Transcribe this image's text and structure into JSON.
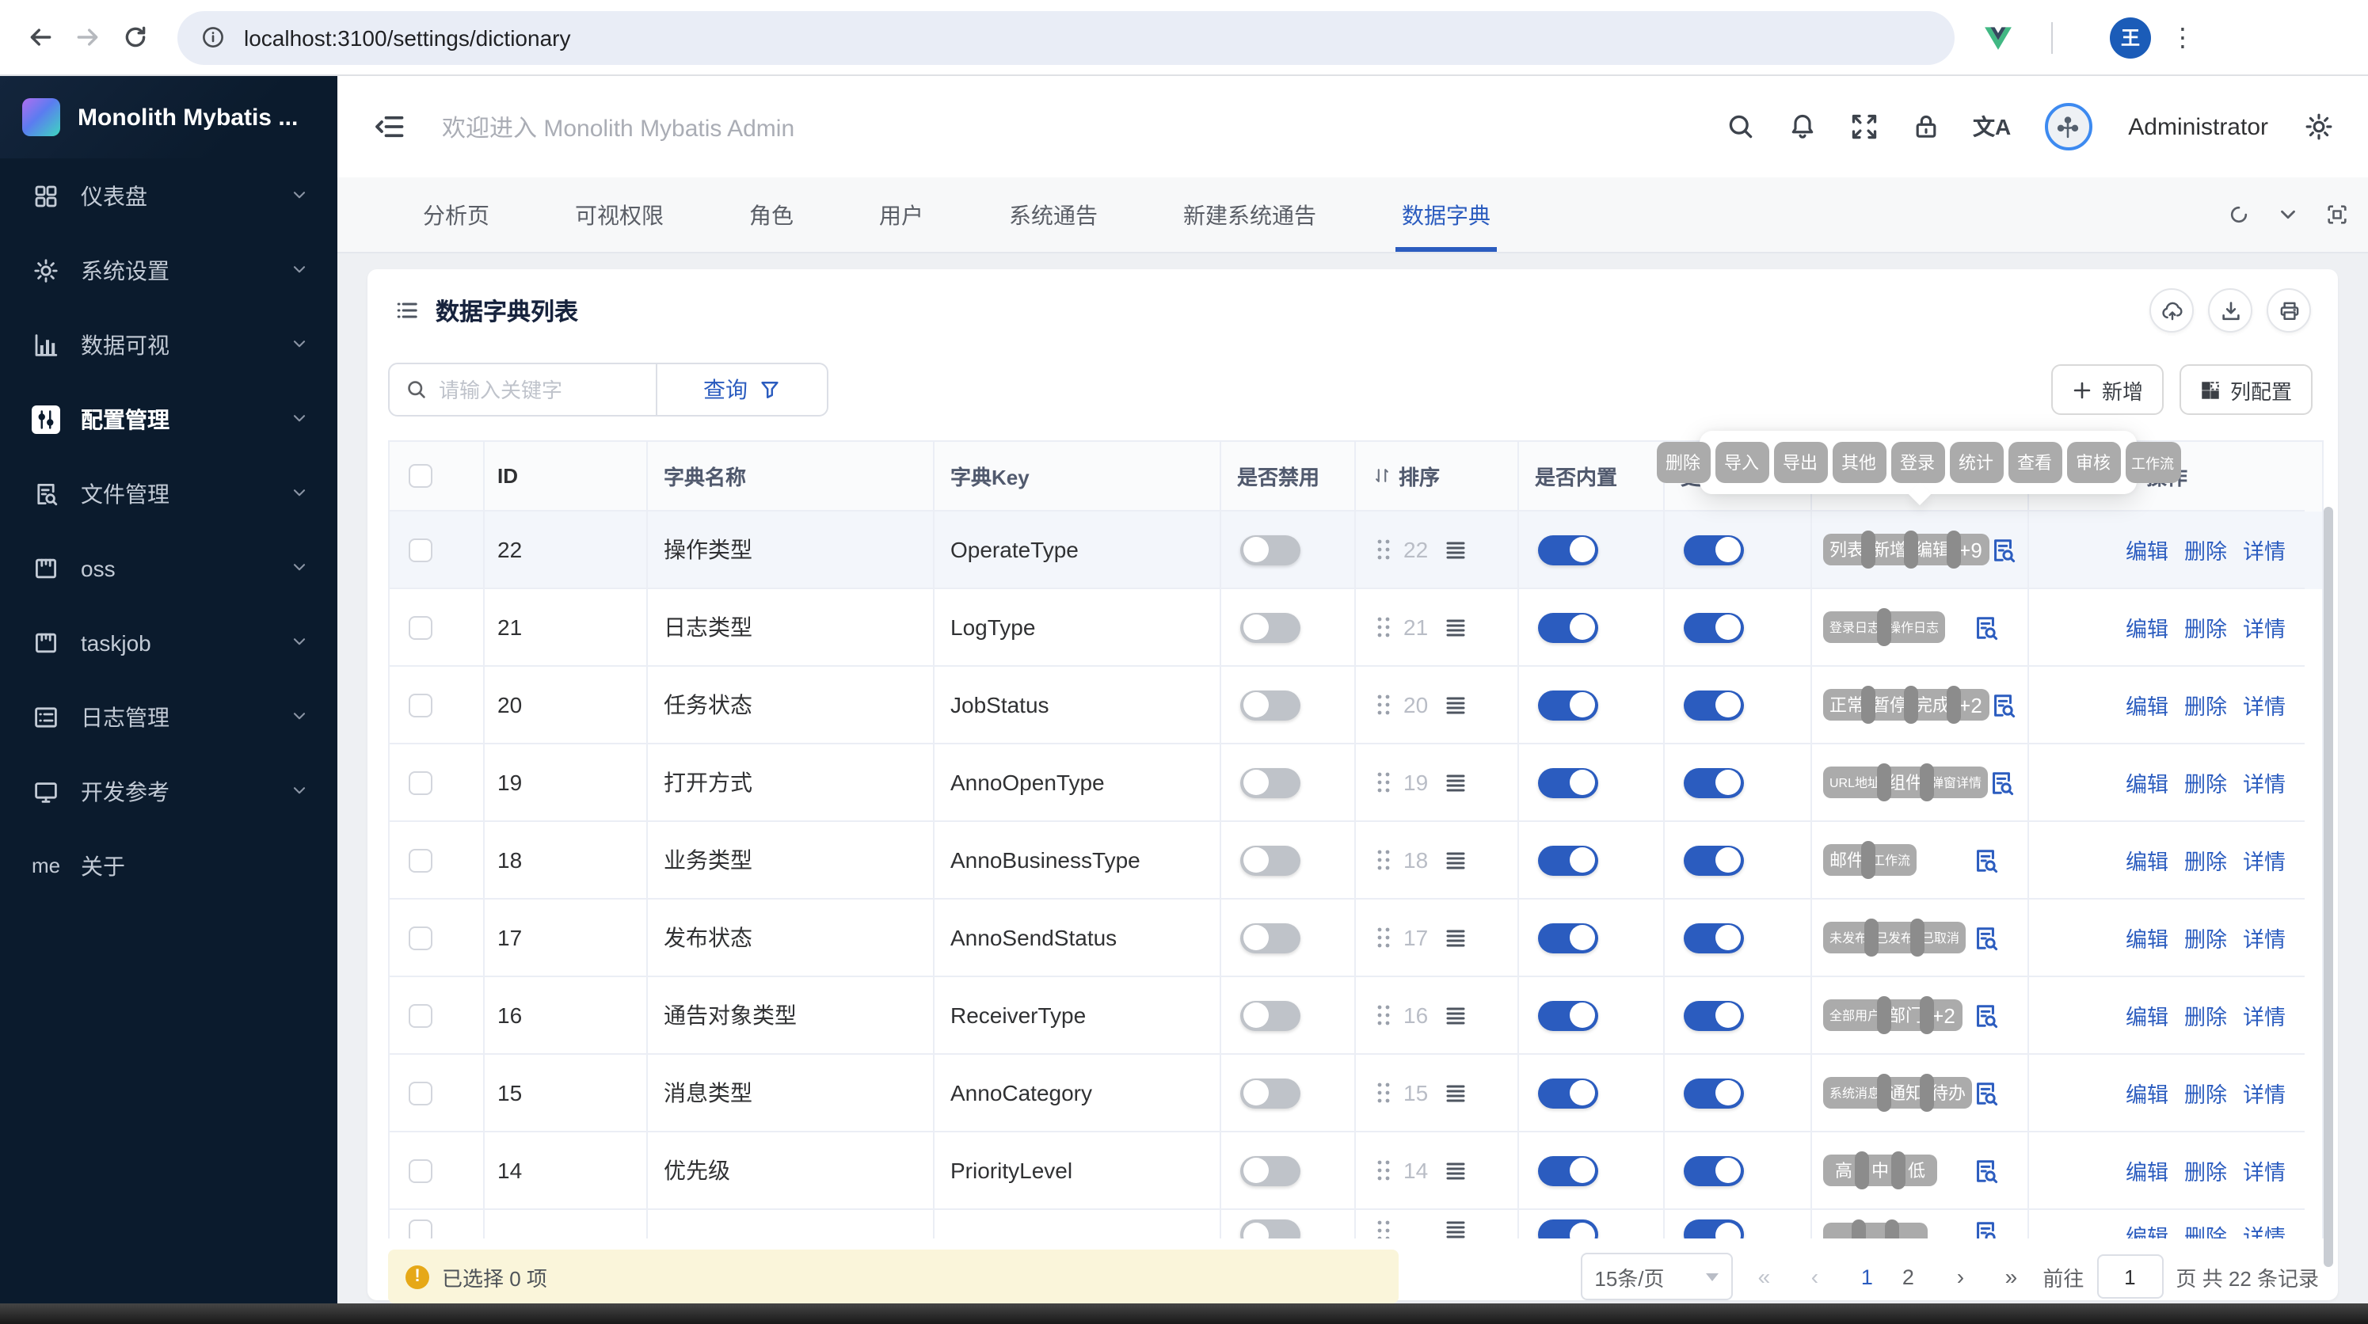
{
  "browser": {
    "url": "localhost:3100/settings/dictionary",
    "profile_glyph": "王"
  },
  "sidebar": {
    "app_title": "Monolith Mybatis ...",
    "items": [
      {
        "key": "dashboard",
        "icon": "dashboard",
        "label": "仪表盘",
        "chevron": true,
        "active": false
      },
      {
        "key": "system-settings",
        "icon": "gear",
        "label": "系统设置",
        "chevron": true,
        "active": false
      },
      {
        "key": "data-visual",
        "icon": "chart",
        "label": "数据可视",
        "chevron": true,
        "active": false
      },
      {
        "key": "config-management",
        "icon": "sliders",
        "label": "配置管理",
        "chevron": true,
        "active": true
      },
      {
        "key": "file-management",
        "icon": "filesearch",
        "label": "文件管理",
        "chevron": true,
        "active": false
      },
      {
        "key": "oss",
        "icon": "box",
        "label": "oss",
        "chevron": true,
        "active": false
      },
      {
        "key": "taskjob",
        "icon": "box",
        "label": "taskjob",
        "chevron": true,
        "active": false
      },
      {
        "key": "log-management",
        "icon": "list",
        "label": "日志管理",
        "chevron": true,
        "active": false
      },
      {
        "key": "dev-reference",
        "icon": "monitor",
        "label": "开发参考",
        "chevron": true,
        "active": false
      },
      {
        "key": "about",
        "icon": "me",
        "label": "关于",
        "chevron": false,
        "active": false
      }
    ]
  },
  "topbar": {
    "welcome": "欢迎进入 Monolith Mybatis Admin",
    "username": "Administrator"
  },
  "tabs": {
    "items": [
      {
        "key": "analysis",
        "label": "分析页",
        "active": false
      },
      {
        "key": "permissions",
        "label": "可视权限",
        "active": false
      },
      {
        "key": "roles",
        "label": "角色",
        "active": false
      },
      {
        "key": "users",
        "label": "用户",
        "active": false
      },
      {
        "key": "notices",
        "label": "系统通告",
        "active": false
      },
      {
        "key": "new-notice",
        "label": "新建系统通告",
        "active": false
      },
      {
        "key": "dictionary",
        "label": "数据字典",
        "active": true
      }
    ]
  },
  "card": {
    "title": "数据字典列表"
  },
  "toolbar": {
    "search_placeholder": "请输入关键字",
    "query_label": "查询",
    "add_label": "新增",
    "columns_label": "列配置"
  },
  "table": {
    "headers": {
      "id": "ID",
      "name": "字典名称",
      "key": "字典Key",
      "disabled": "是否禁用",
      "sort": "排序",
      "builtin": "是否内置",
      "update": "更新",
      "tags": "",
      "actions": "操作"
    },
    "action_labels": [
      "编辑",
      "删除",
      "详情"
    ],
    "rows": [
      {
        "id": "22",
        "name": "操作类型",
        "key": "OperateType",
        "disabled": false,
        "sort": "22",
        "builtin": true,
        "update": true,
        "tags": [
          "列表",
          "新增",
          "编辑"
        ],
        "more": "+9",
        "hover": true
      },
      {
        "id": "21",
        "name": "日志类型",
        "key": "LogType",
        "disabled": false,
        "sort": "21",
        "builtin": true,
        "update": true,
        "tags": [
          "登录日志",
          "操作日志"
        ],
        "more": null
      },
      {
        "id": "20",
        "name": "任务状态",
        "key": "JobStatus",
        "disabled": false,
        "sort": "20",
        "builtin": true,
        "update": true,
        "tags": [
          "正常",
          "暂停",
          "完成"
        ],
        "more": "+2"
      },
      {
        "id": "19",
        "name": "打开方式",
        "key": "AnnoOpenType",
        "disabled": false,
        "sort": "19",
        "builtin": true,
        "update": true,
        "tags": [
          "URL地址",
          "组件",
          "弹窗详情"
        ],
        "more": null
      },
      {
        "id": "18",
        "name": "业务类型",
        "key": "AnnoBusinessType",
        "disabled": false,
        "sort": "18",
        "builtin": true,
        "update": true,
        "tags": [
          "邮件",
          "工作流"
        ],
        "more": null
      },
      {
        "id": "17",
        "name": "发布状态",
        "key": "AnnoSendStatus",
        "disabled": false,
        "sort": "17",
        "builtin": true,
        "update": true,
        "tags": [
          "未发布",
          "已发布",
          "已取消"
        ],
        "more": null
      },
      {
        "id": "16",
        "name": "通告对象类型",
        "key": "ReceiverType",
        "disabled": false,
        "sort": "16",
        "builtin": true,
        "update": true,
        "tags": [
          "全部用户",
          "部门"
        ],
        "more": "+2"
      },
      {
        "id": "15",
        "name": "消息类型",
        "key": "AnnoCategory",
        "disabled": false,
        "sort": "15",
        "builtin": true,
        "update": true,
        "tags": [
          "系统消息",
          "通知",
          "待办"
        ],
        "more": null
      },
      {
        "id": "14",
        "name": "优先级",
        "key": "PriorityLevel",
        "disabled": false,
        "sort": "14",
        "builtin": true,
        "update": true,
        "tags": [
          "高",
          "中",
          "低"
        ],
        "more": null
      },
      {
        "id": "",
        "name": "",
        "key": "",
        "disabled": false,
        "sort": "",
        "builtin": true,
        "update": true,
        "tags": [
          "",
          "",
          ""
        ],
        "more": null,
        "partial": true
      }
    ]
  },
  "popup": {
    "tags": [
      "删除",
      "导入",
      "导出",
      "其他",
      "登录",
      "统计",
      "查看",
      "审核",
      "工作流"
    ]
  },
  "footer": {
    "selected_text": "已选择 0 项",
    "page_size": "15条/页",
    "pages": [
      "1",
      "2"
    ],
    "active_page": "1",
    "goto_label": "前往",
    "goto_value": "1",
    "suffix": "页 共 22 条记录"
  }
}
